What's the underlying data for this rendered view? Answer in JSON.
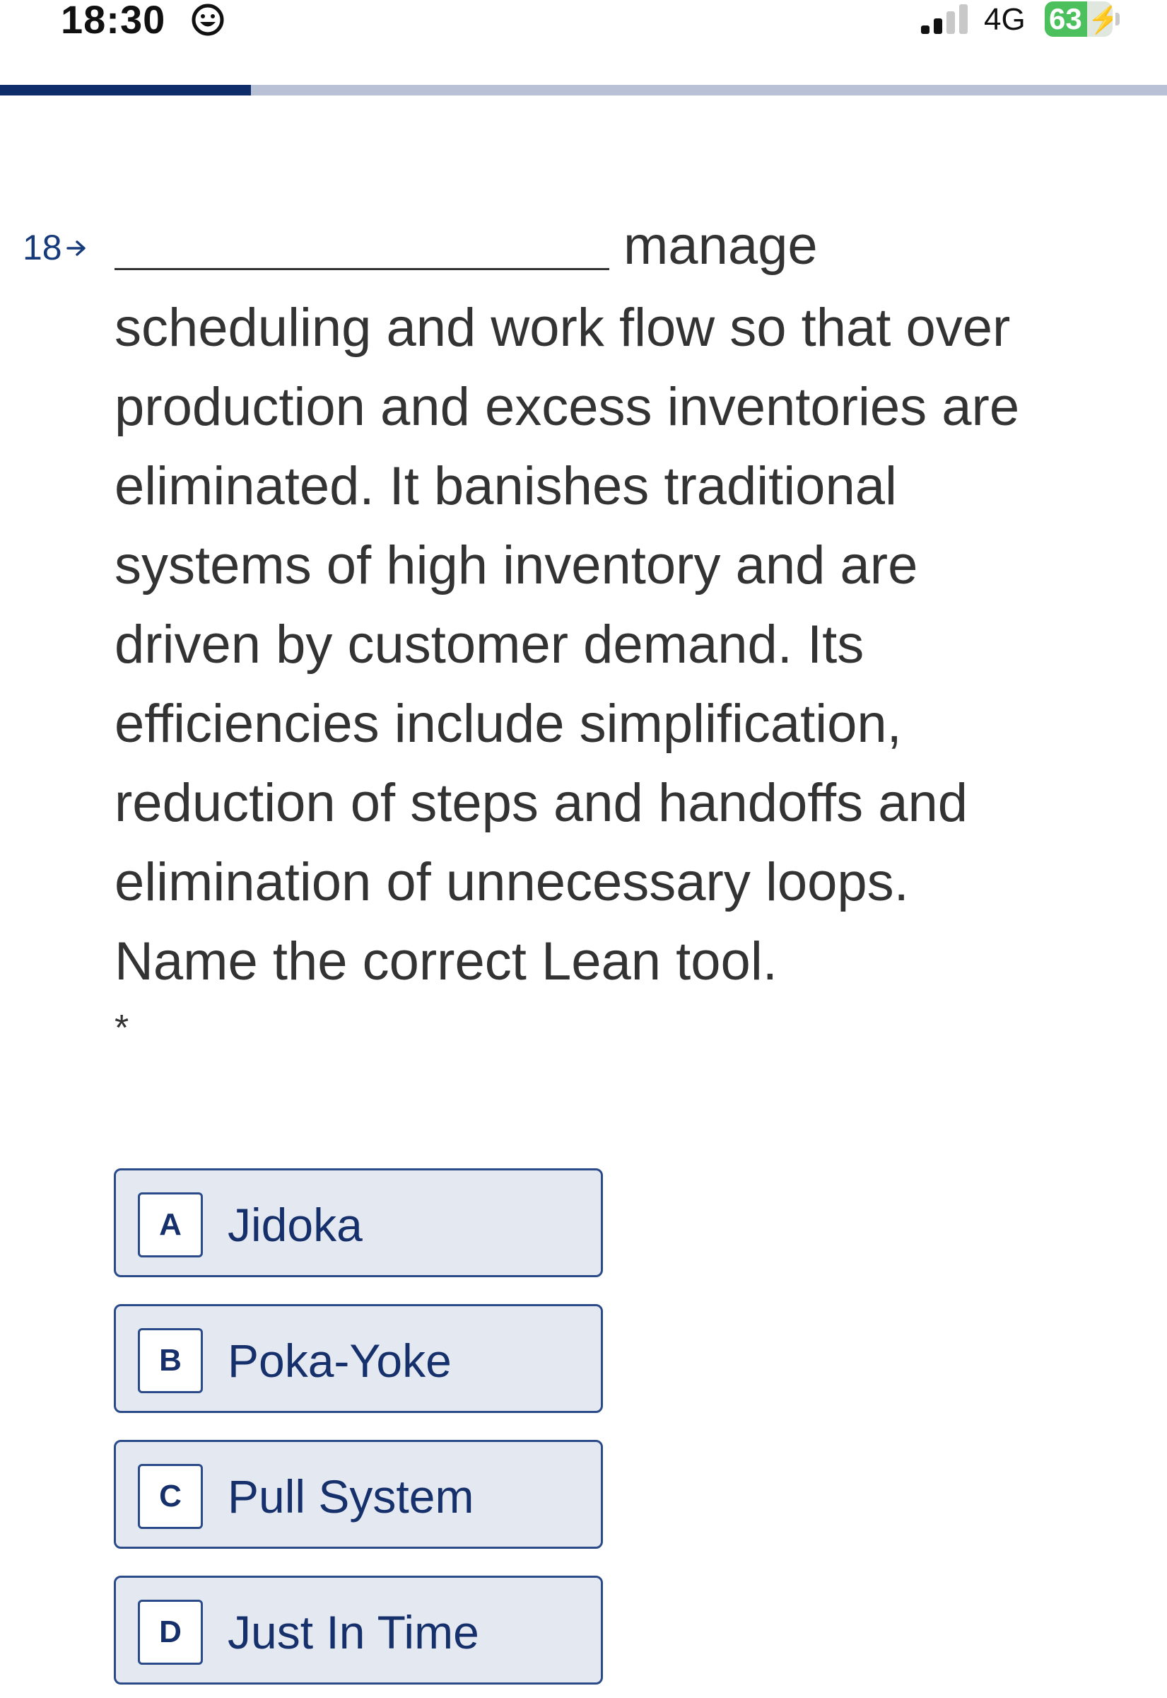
{
  "status_bar": {
    "time": "18:30",
    "status_icon": "smiley-icon",
    "signal_icon": "cellular-signal-icon",
    "signal_bars": 2,
    "signal_bars_total": 4,
    "network": "4G",
    "battery_level": "63",
    "battery_percent": 63,
    "battery_icon": "charging-bolt-icon",
    "battery_color": "#4cc05c"
  },
  "progress": {
    "fraction": 0.215,
    "fill_color": "#0f2d6b",
    "track_color": "#b9c1d6"
  },
  "question": {
    "number": "18",
    "number_icon": "arrow-right-icon",
    "first_word": "manage",
    "lines": [
      "scheduling and work flow so that over",
      "production and excess inventories are",
      "eliminated. It banishes traditional",
      "systems of high inventory and are",
      "driven by customer demand. Its",
      "efficiencies include simplification,",
      "reduction of steps and handoffs and",
      "elimination of unnecessary loops.",
      "Name the correct Lean tool."
    ],
    "required_mark": "*"
  },
  "options": [
    {
      "key": "A",
      "label": "Jidoka"
    },
    {
      "key": "B",
      "label": "Poka-Yoke"
    },
    {
      "key": "C",
      "label": "Pull System"
    },
    {
      "key": "D",
      "label": "Just In Time"
    }
  ]
}
